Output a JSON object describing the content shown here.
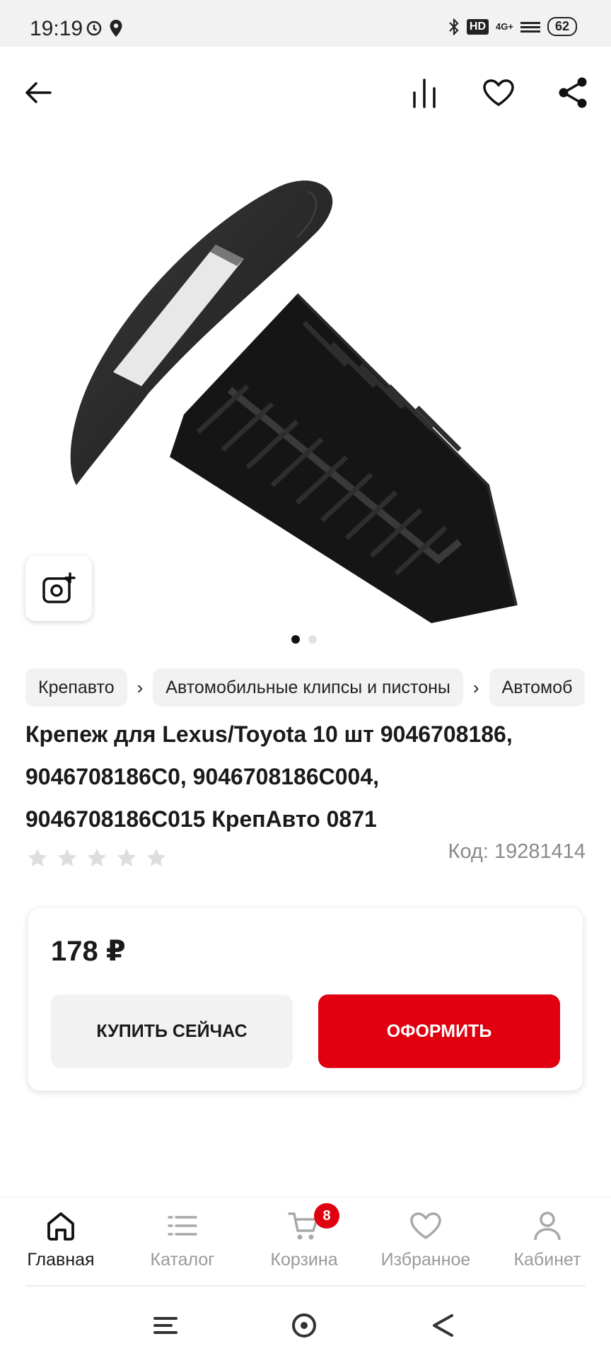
{
  "status_bar": {
    "time": "19:19",
    "network": "HD",
    "signal_label": "4G+",
    "battery": "62"
  },
  "top_bar": {
    "icons": [
      "back-arrow-icon",
      "compare-icon",
      "heart-icon",
      "share-icon"
    ]
  },
  "gallery": {
    "image_count": 2,
    "active_index": 0
  },
  "breadcrumbs": [
    {
      "label": "Крепавто"
    },
    {
      "label": "Автомобильные клипсы и пистоны"
    },
    {
      "label": "Автомоб"
    }
  ],
  "product": {
    "title_lines": [
      "Крепеж для Lexus/Toyota 10 шт 9046708186,",
      "9046708186C0, 9046708186C004,",
      "9046708186C015 КрепАвто 0871"
    ],
    "rating": 0,
    "rating_max": 5,
    "code": "Код: 19281414"
  },
  "price_card": {
    "price": "178 ₽",
    "buy_now_label": "КУПИТЬ СЕЙЧАС",
    "checkout_label": "ОФОРМИТЬ"
  },
  "bottom_nav": {
    "items": [
      {
        "label": "Главная",
        "icon": "home-icon"
      },
      {
        "label": "Каталог",
        "icon": "catalog-list-icon"
      },
      {
        "label": "Корзина",
        "icon": "cart-icon",
        "badge": "8"
      },
      {
        "label": "Избранное",
        "icon": "heart-icon"
      },
      {
        "label": "Кабинет",
        "icon": "user-icon"
      }
    ]
  },
  "colors": {
    "accent": "#e0000f",
    "inactive": "#9a9a9a"
  }
}
